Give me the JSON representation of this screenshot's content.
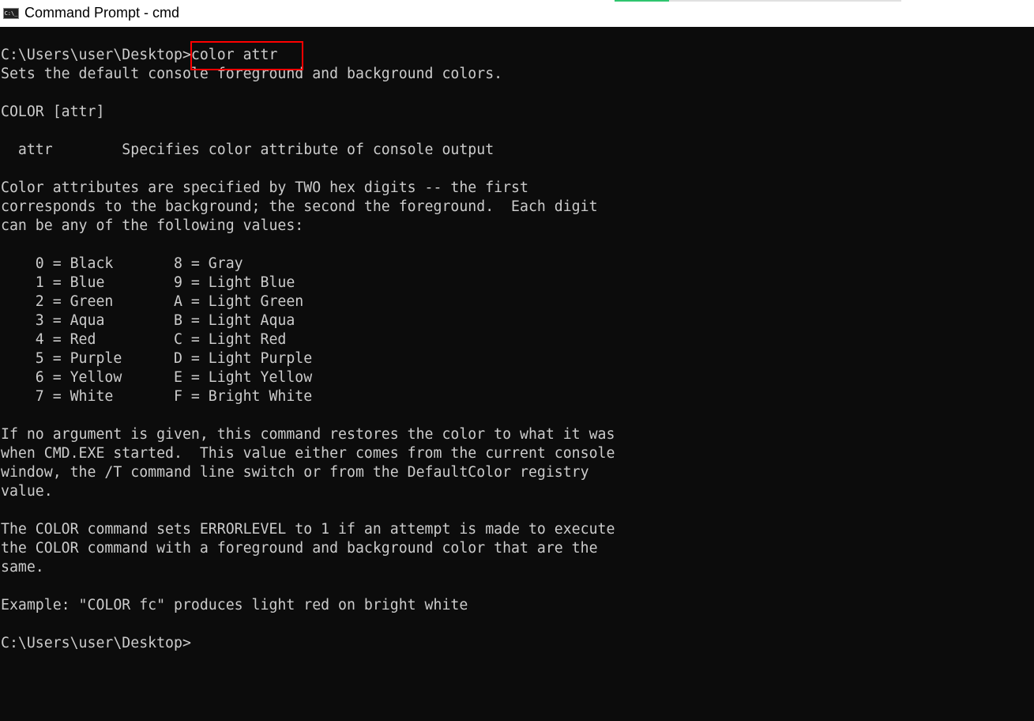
{
  "window": {
    "title": "Command Prompt - cmd",
    "icon": "cmd-icon",
    "icon_text": "C:\\_"
  },
  "progress": {
    "percent": 19,
    "fill_color": "#2fc56f"
  },
  "colors": {
    "background": "#0c0c0c",
    "foreground": "#cccccc",
    "highlight": "#ff0000"
  },
  "console": {
    "prompt": "C:\\Users\\user\\Desktop>",
    "command": "color attr",
    "lines": [
      "Sets the default console foreground and background colors.",
      "",
      "COLOR [attr]",
      "",
      "  attr        Specifies color attribute of console output",
      "",
      "Color attributes are specified by TWO hex digits -- the first",
      "corresponds to the background; the second the foreground.  Each digit",
      "can be any of the following values:",
      "",
      "    0 = Black       8 = Gray",
      "    1 = Blue        9 = Light Blue",
      "    2 = Green       A = Light Green",
      "    3 = Aqua        B = Light Aqua",
      "    4 = Red         C = Light Red",
      "    5 = Purple      D = Light Purple",
      "    6 = Yellow      E = Light Yellow",
      "    7 = White       F = Bright White",
      "",
      "If no argument is given, this command restores the color to what it was",
      "when CMD.EXE started.  This value either comes from the current console",
      "window, the /T command line switch or from the DefaultColor registry",
      "value.",
      "",
      "The COLOR command sets ERRORLEVEL to 1 if an attempt is made to execute",
      "the COLOR command with a foreground and background color that are the",
      "same.",
      "",
      "Example: \"COLOR fc\" produces light red on bright white",
      ""
    ],
    "final_prompt": "C:\\Users\\user\\Desktop>"
  }
}
